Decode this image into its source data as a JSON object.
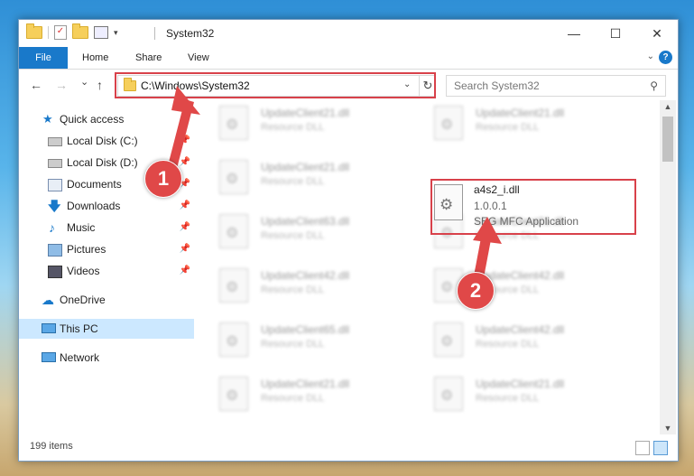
{
  "window": {
    "title": "System32",
    "buttons": {
      "minimize": "—",
      "maximize": "☐",
      "close": "✕"
    }
  },
  "ribbon": {
    "tabs": [
      {
        "label": "File",
        "active": true
      },
      {
        "label": "Home"
      },
      {
        "label": "Share"
      },
      {
        "label": "View"
      }
    ],
    "help": "?"
  },
  "navigation": {
    "back": "←",
    "forward": "→",
    "recent": "⌄",
    "up": "↑",
    "address": "C:\\Windows\\System32",
    "search_placeholder": "Search System32"
  },
  "sidebar": {
    "items": [
      {
        "label": "Quick access",
        "icon": "star-icon"
      },
      {
        "label": "Local Disk (C:)",
        "icon": "drive-icon",
        "pinned": true
      },
      {
        "label": "Local Disk (D:)",
        "icon": "drive-icon",
        "pinned": true
      },
      {
        "label": "Documents",
        "icon": "documents-icon",
        "pinned": true
      },
      {
        "label": "Downloads",
        "icon": "download-icon",
        "pinned": true
      },
      {
        "label": "Music",
        "icon": "music-icon",
        "pinned": true
      },
      {
        "label": "Pictures",
        "icon": "pictures-icon",
        "pinned": true
      },
      {
        "label": "Videos",
        "icon": "videos-icon",
        "pinned": true
      },
      {
        "label": "OneDrive",
        "icon": "cloud-icon"
      },
      {
        "label": "This PC",
        "icon": "computer-icon",
        "selected": true
      },
      {
        "label": "Network",
        "icon": "network-icon"
      }
    ]
  },
  "files": {
    "left_column": [
      {
        "name": "UpdateClient21.dll",
        "type": "Resource DLL"
      },
      {
        "name": "UpdateClient21.dll",
        "type": "Resource DLL"
      },
      {
        "name": "UpdateClient63.dll",
        "type": "Resource DLL"
      },
      {
        "name": "UpdateClient42.dll",
        "type": "Resource DLL"
      },
      {
        "name": "UpdateClient65.dll",
        "type": "Resource DLL"
      },
      {
        "name": "UpdateClient21.dll",
        "type": "Resource DLL"
      }
    ],
    "right_column": [
      {
        "name": "UpdateClient21.dll",
        "type": "Resource DLL"
      },
      {
        "name": "UpdateClient21.dll",
        "type": "Resource DLL"
      },
      {
        "name": "UpdateClient42.dll",
        "type": "Resource DLL"
      },
      {
        "name": "UpdateClient42.dll",
        "type": "Resource DLL"
      },
      {
        "name": "UpdateClient21.dll",
        "type": "Resource DLL"
      }
    ],
    "highlighted": {
      "name": "a4s2_i.dll",
      "version": "1.0.0.1",
      "description": "SEG MFC Application"
    }
  },
  "status": {
    "item_count": "199 items"
  },
  "annotations": {
    "step1": "1",
    "step2": "2",
    "highlight_color": "#d8414a"
  }
}
